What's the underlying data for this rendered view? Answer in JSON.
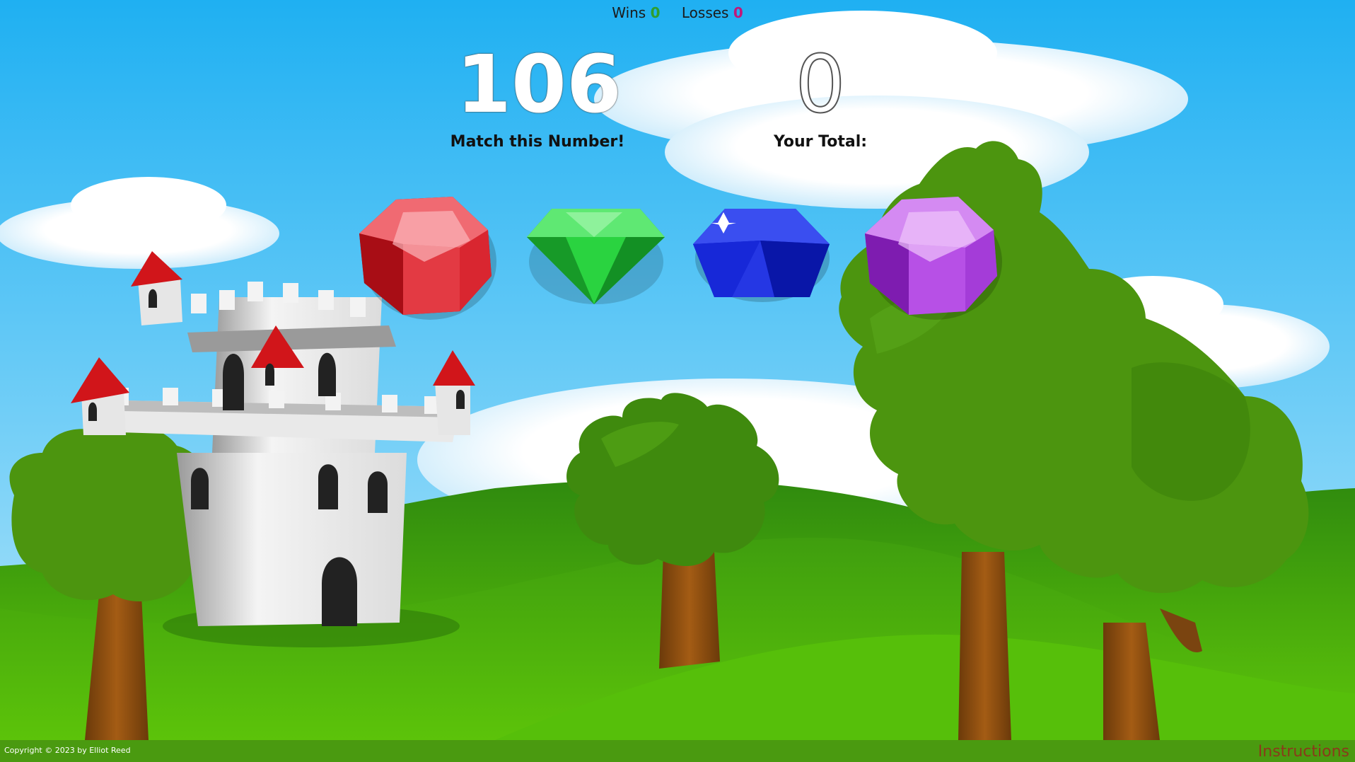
{
  "scoreboard": {
    "wins_label": "Wins",
    "wins_value": "0",
    "losses_label": "Losses",
    "losses_value": "0"
  },
  "target": {
    "value": "106",
    "label": "Match this Number!"
  },
  "total": {
    "value": "0",
    "label": "Your Total:"
  },
  "gems": [
    {
      "name": "red-gem",
      "color": "#e0242a"
    },
    {
      "name": "green-gem",
      "color": "#22c43a"
    },
    {
      "name": "blue-gem",
      "color": "#1626d8"
    },
    {
      "name": "purple-gem",
      "color": "#b040e0"
    }
  ],
  "footer": {
    "copyright": "Copyright © 2023 by Elliot Reed",
    "instructions": "Instructions"
  },
  "colors": {
    "sky": "#29b6f0",
    "grass": "#4fb80c",
    "footer": "#4a9a10"
  }
}
